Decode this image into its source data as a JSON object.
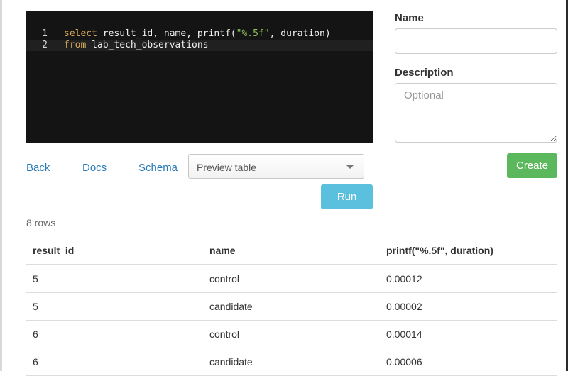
{
  "editor": {
    "lines": [
      {
        "number": "1",
        "kw": "select",
        "rest_a": " result_id, name, printf(",
        "string": "\"%.5f\"",
        "rest_b": ", duration)"
      },
      {
        "number": "2",
        "kw": "from",
        "rest": " lab_tech_observations"
      }
    ]
  },
  "links": {
    "back": "Back",
    "docs": "Docs",
    "schema": "Schema"
  },
  "preview_select": {
    "value": "Preview table"
  },
  "run_button": {
    "label": "Run"
  },
  "form": {
    "name_label": "Name",
    "name_value": "",
    "description_label": "Description",
    "description_placeholder": "Optional",
    "create_label": "Create"
  },
  "results": {
    "row_count": "8 rows",
    "columns": [
      "result_id",
      "name",
      "printf(\"%.5f\", duration)"
    ],
    "rows": [
      [
        "5",
        "control",
        "0.00012"
      ],
      [
        "5",
        "candidate",
        "0.00002"
      ],
      [
        "6",
        "control",
        "0.00014"
      ],
      [
        "6",
        "candidate",
        "0.00006"
      ]
    ]
  },
  "colors": {
    "editor_bg": "#141414",
    "link": "#2a7ab7",
    "run_button": "#5bc0de",
    "create_button": "#5cb85c",
    "keyword": "#d6a85c",
    "string": "#8fbf5a"
  }
}
